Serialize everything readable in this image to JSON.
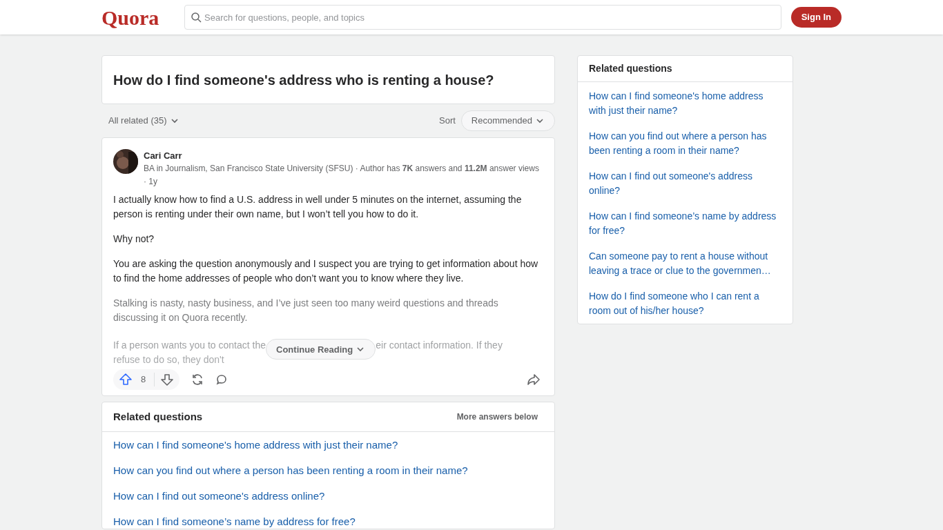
{
  "header": {
    "logo": "Quora",
    "search": {
      "placeholder": "Search for questions, people, and topics"
    },
    "sign_in": "Sign In"
  },
  "question": {
    "title": "How do I find someone's address who is renting a house?"
  },
  "filter_bar": {
    "all_related": "All related (35)",
    "sort_label": "Sort",
    "sort_value": "Recommended"
  },
  "answer": {
    "author": "Cari Carr",
    "credentials": "BA in Journalism, San Francisco State University (SFSU) · Author has **7K** answers and **11.2M** answer views · 1y",
    "paragraphs": [
      "I actually know how to find a U.S. address in well under 5 minutes on the internet, assuming the person is renting under their own name, but I won’t tell you how to do it.",
      "Why not?",
      "You are asking the question anonymously and I suspect you are trying to get information about how to find the home addresses of people who don’t want you to know where they live.",
      "Stalking is nasty, nasty business, and I’ve just seen too many weird questions and threads discussing it on Quora recently."
    ],
    "faded_before": "If a person wants you to contact the",
    "faded_after": "eir contact information. If they",
    "faded_line_2": "refuse to do so, they don't",
    "continue_reading": "Continue Reading",
    "upvotes": "8"
  },
  "related_inline": {
    "title": "Related questions",
    "note": "More answers below",
    "items": [
      "How can I find someone's home address with just their name?",
      "How can you find out where a person has been renting a room in their name?",
      "How can I find out someone's address online?",
      "How can I find someone’s name by address for free?"
    ]
  },
  "related_sidebar": {
    "title": "Related questions",
    "items": [
      "How can I find someone's home address with just their name?",
      "How can you find out where a person has been renting a room in their name?",
      "How can I find out someone's address online?",
      "How can I find someone’s name by address for free?",
      "Can someone pay to rent a house without leaving a trace or clue to the governmen…",
      "How do I find someone who I can rent a room out of his/her house?"
    ]
  }
}
